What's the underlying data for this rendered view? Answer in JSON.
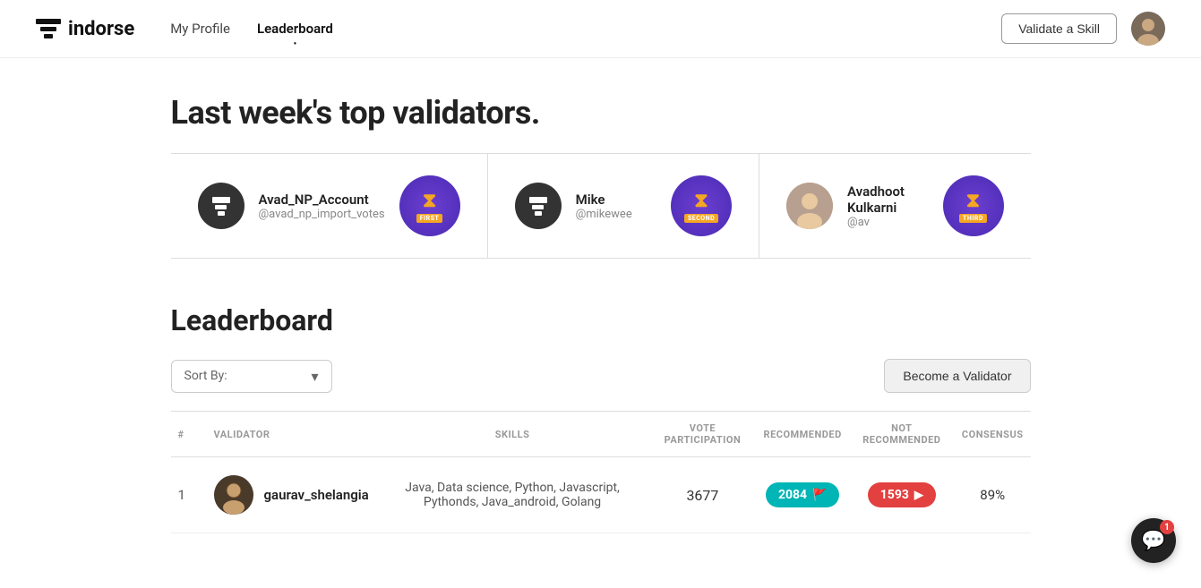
{
  "brand": {
    "logo_text": "indorse"
  },
  "navbar": {
    "my_profile_label": "My Profile",
    "leaderboard_label": "Leaderboard",
    "validate_skill_btn": "Validate a Skill",
    "active_link": "leaderboard"
  },
  "top_validators": {
    "section_title": "Last week's top validators.",
    "validators": [
      {
        "name": "Avad_NP_Account",
        "handle": "@avad_np_import_votes",
        "badge_label": "FIRST",
        "rank": 1
      },
      {
        "name": "Mike",
        "handle": "@mikewee",
        "badge_label": "SECOND",
        "rank": 2
      },
      {
        "name": "Avadhoot Kulkarni",
        "handle": "@av",
        "badge_label": "THIRD",
        "rank": 3
      }
    ]
  },
  "leaderboard": {
    "section_title": "Leaderboard",
    "sort_by_label": "Sort By:",
    "become_validator_btn": "Become a Validator",
    "columns": {
      "rank": "#",
      "validator": "VALIDATOR",
      "skills": "SKILLS",
      "vote_participation": "VOTE PARTICIPATION",
      "recommended": "RECOMMENDED",
      "not_recommended": "NOT RECOMMENDED",
      "consensus": "CONSENSUS"
    },
    "rows": [
      {
        "rank": 1,
        "username": "gaurav_shelangia",
        "skills": "Java, Data science, Python, Javascript, Pythonds, Java_android, Golang",
        "vote_participation": "3677",
        "recommended": "2084",
        "not_recommended": "1593",
        "consensus": "89%"
      }
    ]
  },
  "chat": {
    "badge_count": "1"
  },
  "colors": {
    "badge_green": "#00b5b5",
    "badge_red": "#e34040",
    "badge_purple": "#5a2dcf"
  }
}
